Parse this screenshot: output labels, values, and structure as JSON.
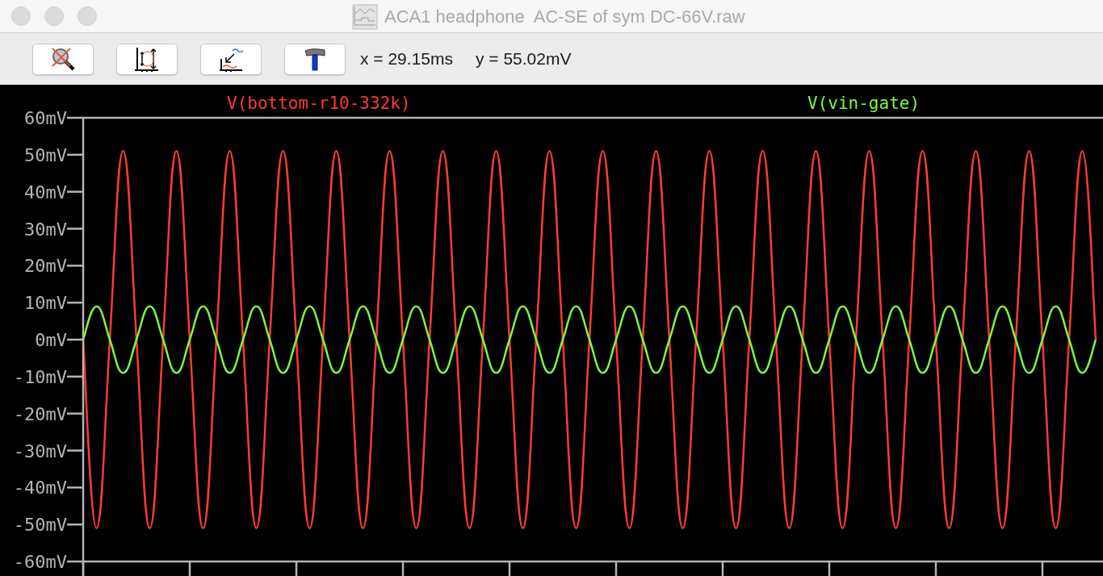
{
  "window": {
    "title": "ACA1 headphone  AC-SE of sym DC-66V.raw"
  },
  "toolbar": {
    "readouts": [
      "x = 29.15ms",
      "y = 55.02mV"
    ]
  },
  "plot": {
    "chart_data": {
      "type": "line",
      "ylim": [
        -60,
        60
      ],
      "yticks": [
        {
          "value": 60,
          "label": "60mV"
        },
        {
          "value": 50,
          "label": "50mV"
        },
        {
          "value": 40,
          "label": "40mV"
        },
        {
          "value": 30,
          "label": "30mV"
        },
        {
          "value": 20,
          "label": "20mV"
        },
        {
          "value": 10,
          "label": "10mV"
        },
        {
          "value": 0,
          "label": "0mV"
        },
        {
          "value": -10,
          "label": "-10mV"
        },
        {
          "value": -20,
          "label": "-20mV"
        },
        {
          "value": -30,
          "label": "-30mV"
        },
        {
          "value": -40,
          "label": "-40mV"
        },
        {
          "value": -50,
          "label": "-50mV"
        },
        {
          "value": -60,
          "label": "-60mV"
        }
      ],
      "series": [
        {
          "name": "V(bottom-r10-332k)",
          "color": "#ff3b30",
          "values": [
            0,
            -51,
            0,
            51,
            0,
            -51,
            0,
            51,
            0,
            -51,
            0,
            51,
            0,
            -51,
            0,
            51,
            0,
            -51,
            0,
            51,
            0,
            -51,
            0,
            51,
            0,
            -51,
            0,
            51,
            0,
            -51,
            0,
            51,
            0,
            -51,
            0,
            51,
            0,
            -51,
            0,
            51,
            0,
            -51,
            0,
            51,
            0,
            -51,
            0,
            51,
            0,
            -51,
            0,
            51,
            0,
            -51,
            0,
            51,
            0,
            -51,
            0,
            51,
            0,
            -51,
            0,
            51,
            0,
            -51,
            0,
            51,
            0,
            -51,
            0,
            51,
            0,
            -51,
            0,
            51,
            0
          ]
        },
        {
          "name": "V(vin-gate)",
          "color": "#7cfc3a",
          "values": [
            0,
            9,
            0,
            -9,
            0,
            9,
            0,
            -9,
            0,
            9,
            0,
            -9,
            0,
            9,
            0,
            -9,
            0,
            9,
            0,
            -9,
            0,
            9,
            0,
            -9,
            0,
            9,
            0,
            -9,
            0,
            9,
            0,
            -9,
            0,
            9,
            0,
            -9,
            0,
            9,
            0,
            -9,
            0,
            9,
            0,
            -9,
            0,
            9,
            0,
            -9,
            0,
            9,
            0,
            -9,
            0,
            9,
            0,
            -9,
            0,
            9,
            0,
            -9,
            0,
            9,
            0,
            -9,
            0,
            9,
            0,
            -9,
            0,
            9,
            0,
            -9,
            0,
            9,
            0,
            -9,
            0
          ]
        }
      ]
    }
  }
}
